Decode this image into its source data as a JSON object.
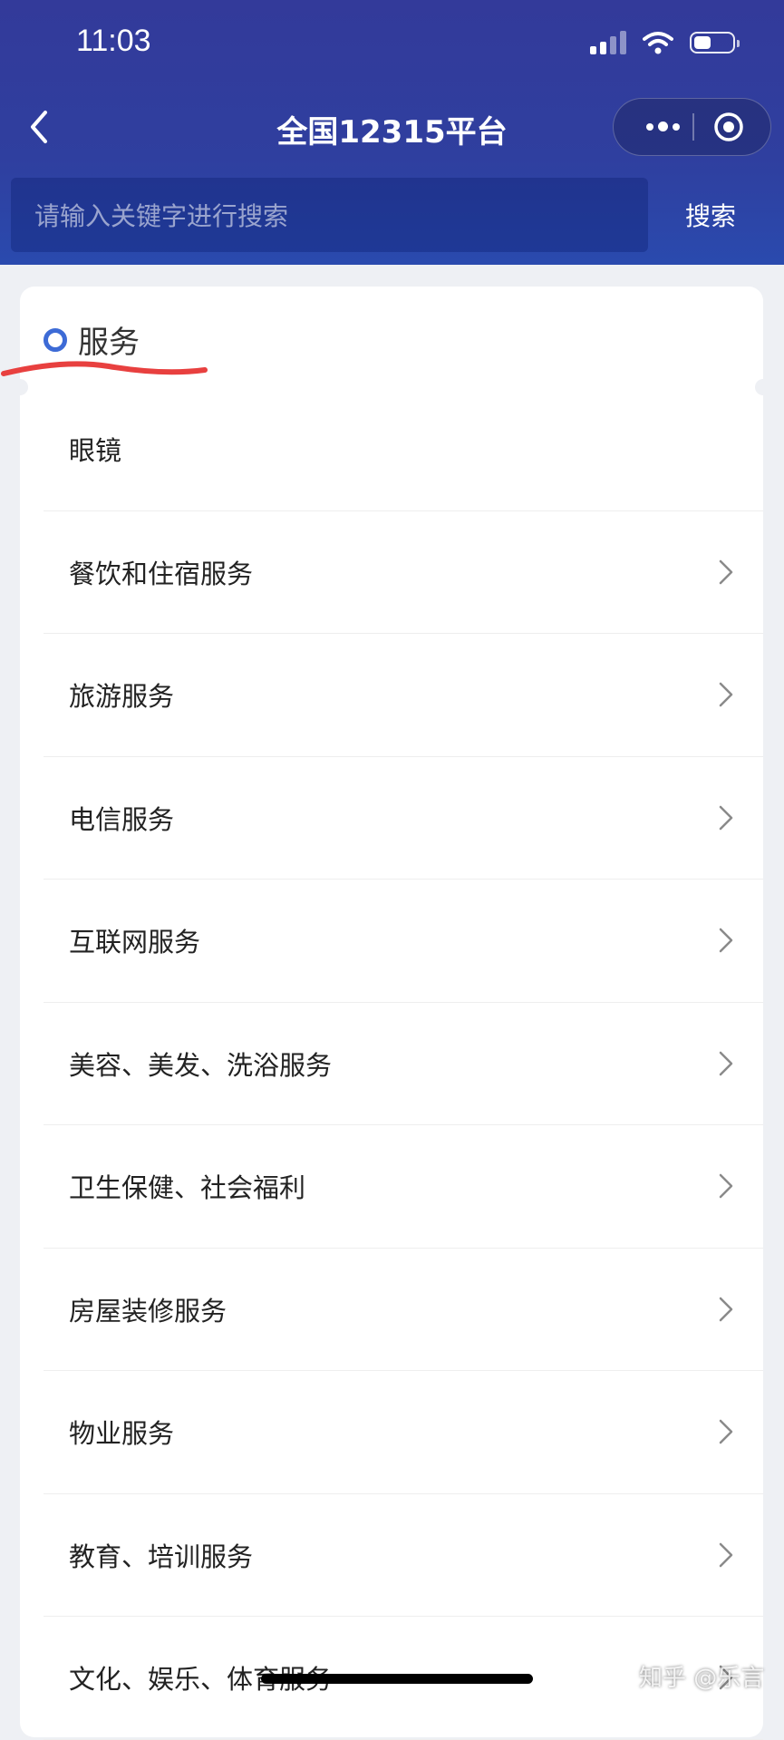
{
  "status_bar": {
    "time": "11:03"
  },
  "nav": {
    "title": "全国12315平台"
  },
  "search": {
    "placeholder": "请输入关键字进行搜索",
    "button_label": "搜索"
  },
  "section": {
    "title": "服务"
  },
  "items": [
    {
      "label": "眼镜"
    },
    {
      "label": "餐饮和住宿服务"
    },
    {
      "label": "旅游服务"
    },
    {
      "label": "电信服务"
    },
    {
      "label": "互联网服务"
    },
    {
      "label": "美容、美发、洗浴服务"
    },
    {
      "label": "卫生保健、社会福利"
    },
    {
      "label": "房屋装修服务"
    },
    {
      "label": "物业服务"
    },
    {
      "label": "教育、培训服务"
    },
    {
      "label": "文化、娱乐、体育服务"
    }
  ],
  "watermark": "知乎 @乐言",
  "colors": {
    "header": "#2f3f9f",
    "accent": "#3d6bd6",
    "annotation": "#e8403f"
  },
  "icons": [
    "back-arrow-icon",
    "more-dots-icon",
    "close-target-icon",
    "chevron-right-icon",
    "wifi-icon",
    "battery-icon",
    "signal-icon"
  ]
}
